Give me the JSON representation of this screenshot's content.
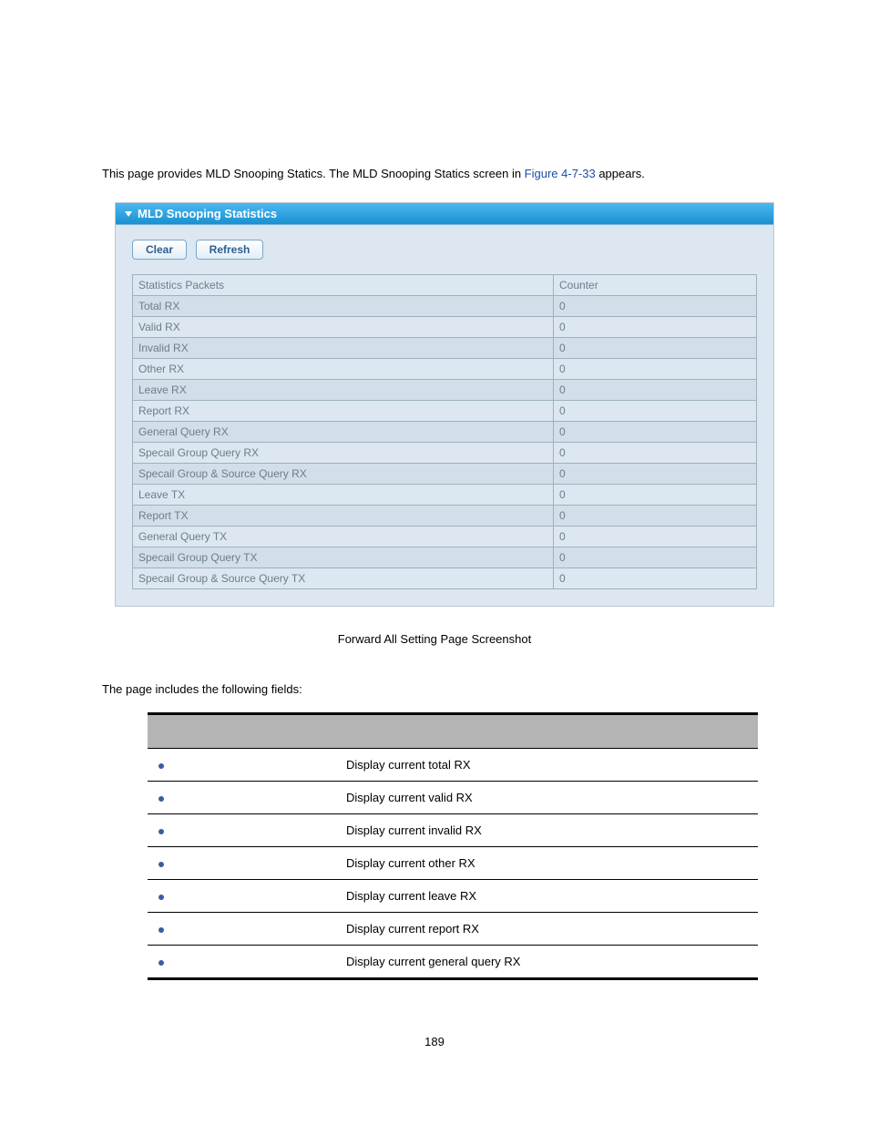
{
  "intro": {
    "prefix": "This page provides MLD Snooping Statics. The MLD Snooping Statics screen in ",
    "link": "Figure 4-7-33",
    "suffix": " appears."
  },
  "panel": {
    "title": "MLD Snooping Statistics",
    "buttons": {
      "clear": "Clear",
      "refresh": "Refresh"
    },
    "headers": {
      "packets": "Statistics Packets",
      "counter": "Counter"
    },
    "rows": [
      {
        "label": "Total RX",
        "value": "0"
      },
      {
        "label": "Valid RX",
        "value": "0"
      },
      {
        "label": "Invalid RX",
        "value": "0"
      },
      {
        "label": "Other RX",
        "value": "0"
      },
      {
        "label": "Leave RX",
        "value": "0"
      },
      {
        "label": "Report RX",
        "value": "0"
      },
      {
        "label": "General Query RX",
        "value": "0"
      },
      {
        "label": "Specail Group Query RX",
        "value": "0"
      },
      {
        "label": "Specail Group & Source Query RX",
        "value": "0"
      },
      {
        "label": "Leave TX",
        "value": "0"
      },
      {
        "label": "Report TX",
        "value": "0"
      },
      {
        "label": "General Query TX",
        "value": "0"
      },
      {
        "label": "Specail Group Query TX",
        "value": "0"
      },
      {
        "label": "Specail Group & Source Query TX",
        "value": "0"
      }
    ]
  },
  "caption": "Forward All Setting Page Screenshot",
  "fields_intro": "The page includes the following fields:",
  "desc_rows": [
    {
      "desc": "Display current total RX"
    },
    {
      "desc": "Display current valid RX"
    },
    {
      "desc": "Display current invalid RX"
    },
    {
      "desc": "Display current other RX"
    },
    {
      "desc": "Display current leave RX"
    },
    {
      "desc": "Display current report RX"
    },
    {
      "desc": "Display current general query RX"
    }
  ],
  "page_number": "189"
}
